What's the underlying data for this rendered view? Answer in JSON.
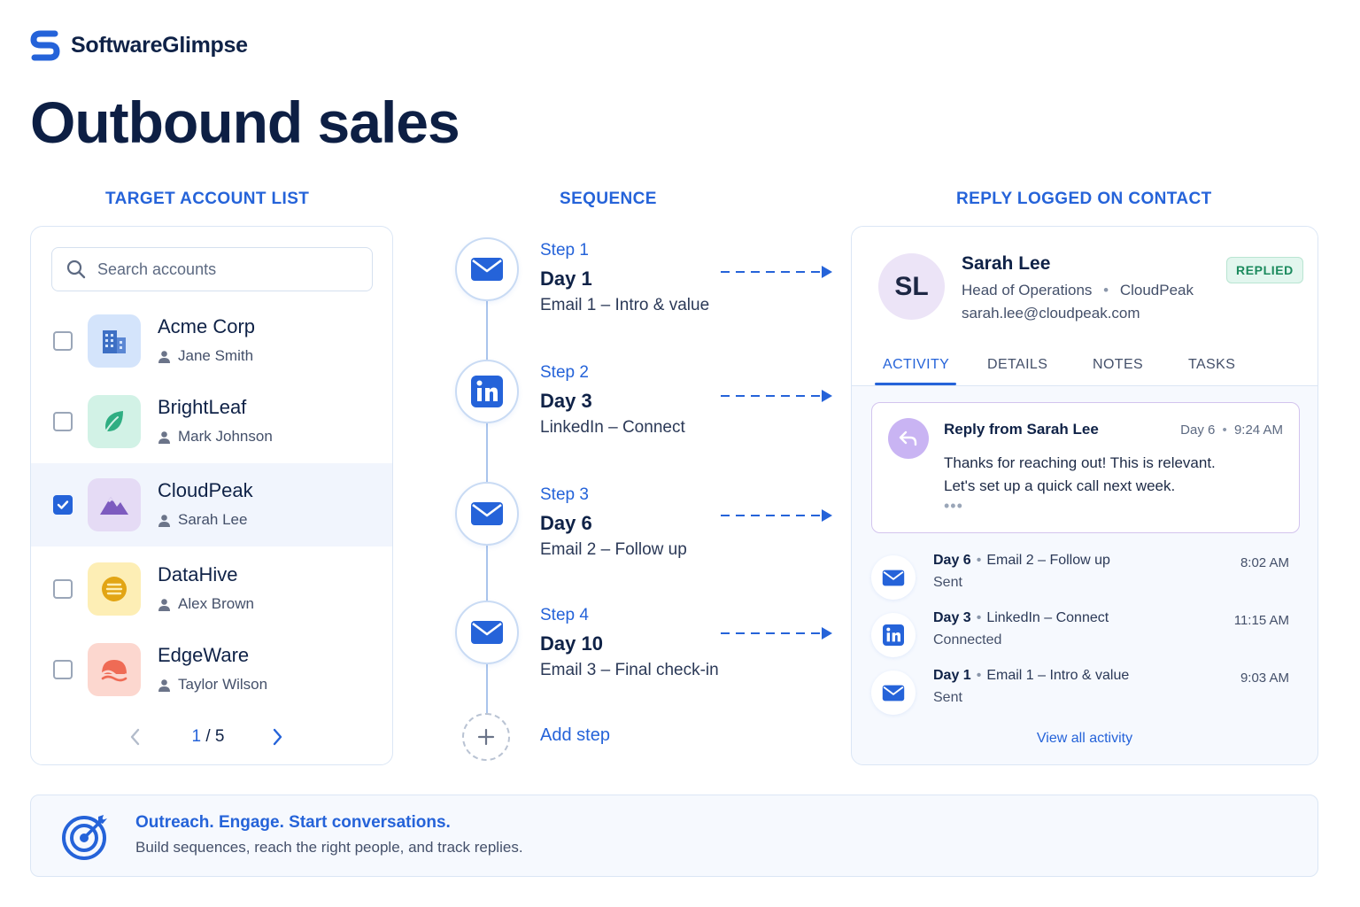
{
  "brand": {
    "name": "SoftwareGlimpse",
    "logo_icon": "s-logo-icon",
    "color": "#2563d9"
  },
  "page_title": "Outbound sales",
  "sections": {
    "accounts_heading": "TARGET ACCOUNT LIST",
    "sequence_heading": "SEQUENCE",
    "contact_heading": "REPLY LOGGED ON CONTACT"
  },
  "accounts": {
    "search_placeholder": "Search accounts",
    "items": [
      {
        "name": "Acme Corp",
        "contact": "Jane Smith",
        "checked": false,
        "icon": "building-icon",
        "color": "#d4e4fb"
      },
      {
        "name": "BrightLeaf",
        "contact": "Mark Johnson",
        "checked": false,
        "icon": "leaf-icon",
        "color": "#d2f2e6"
      },
      {
        "name": "CloudPeak",
        "contact": "Sarah Lee",
        "checked": true,
        "icon": "mountain-icon",
        "color": "#e5dbf5"
      },
      {
        "name": "DataHive",
        "contact": "Alex Brown",
        "checked": false,
        "icon": "hive-icon",
        "color": "#fdeeb5"
      },
      {
        "name": "EdgeWare",
        "contact": "Taylor Wilson",
        "checked": false,
        "icon": "wave-icon",
        "color": "#fcd7cf"
      }
    ],
    "pager": {
      "current": "1",
      "separator": "/",
      "total": "5"
    }
  },
  "sequence": {
    "steps": [
      {
        "label": "Step 1",
        "day": "Day 1",
        "desc": "Email 1 – Intro & value",
        "icon": "mail-icon"
      },
      {
        "label": "Step 2",
        "day": "Day 3",
        "desc": "LinkedIn – Connect",
        "icon": "linkedin-icon"
      },
      {
        "label": "Step 3",
        "day": "Day 6",
        "desc": "Email 2 – Follow up",
        "icon": "mail-icon"
      },
      {
        "label": "Step 4",
        "day": "Day 10",
        "desc": "Email 3 – Final check-in",
        "icon": "mail-icon"
      }
    ],
    "add_step": "Add step"
  },
  "contact": {
    "initials": "SL",
    "name": "Sarah Lee",
    "role": "Head of Operations",
    "company": "CloudPeak",
    "email": "sarah.lee@cloudpeak.com",
    "badge": "REPLIED",
    "tabs": [
      "ACTIVITY",
      "DETAILS",
      "NOTES",
      "TASKS"
    ],
    "active_tab": "ACTIVITY",
    "reply": {
      "title": "Reply from Sarah Lee",
      "day": "Day 6",
      "time": "9:24 AM",
      "line1": "Thanks for reaching out! This is relevant.",
      "line2": "Let's set up a quick call next week.",
      "more": "•••"
    },
    "activity": [
      {
        "day": "Day 6",
        "action": "Email 2 – Follow up",
        "status": "Sent",
        "time": "8:02 AM",
        "icon": "mail-icon"
      },
      {
        "day": "Day 3",
        "action": "LinkedIn – Connect",
        "status": "Connected",
        "time": "11:15 AM",
        "icon": "linkedin-icon"
      },
      {
        "day": "Day 1",
        "action": "Email 1 – Intro & value",
        "status": "Sent",
        "time": "9:03 AM",
        "icon": "mail-icon"
      }
    ],
    "view_all": "View all activity"
  },
  "footer": {
    "headline": "Outreach. Engage. Start conversations.",
    "subtext": "Build sequences, reach the right people, and track replies.",
    "icon": "target-icon"
  }
}
